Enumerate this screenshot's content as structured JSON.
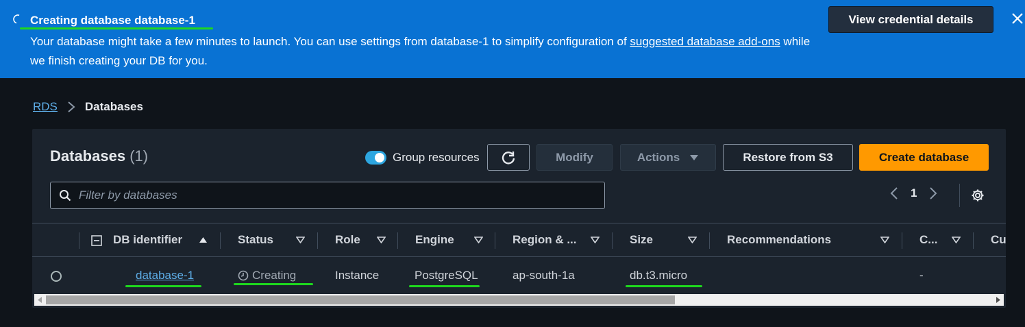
{
  "flash": {
    "title": "Creating database database-1",
    "message_prefix": "Your database might take a few minutes to launch. You can use settings from database-1 to simplify configuration of ",
    "message_link": "suggested database add-ons",
    "message_suffix": " while we finish creating your DB for you.",
    "view_credentials_label": "View credential details",
    "color": "#0972d3"
  },
  "breadcrumb": {
    "root": "RDS",
    "current": "Databases"
  },
  "panel": {
    "title": "Databases",
    "count": "(1)",
    "group_resources_label": "Group resources",
    "group_resources_enabled": true,
    "modify_label": "Modify",
    "actions_label": "Actions",
    "restore_label": "Restore from S3",
    "create_label": "Create database",
    "filter_placeholder": "Filter by databases",
    "page_number": "1"
  },
  "table": {
    "columns": [
      "DB identifier",
      "Status",
      "Role",
      "Engine",
      "Region & ...",
      "Size",
      "Recommendations",
      "C...",
      "Cu"
    ],
    "rows": [
      {
        "db_identifier": "database-1",
        "status": "Creating",
        "role": "Instance",
        "engine": "PostgreSQL",
        "region": "ap-south-1a",
        "size": "db.t3.micro",
        "recommendations": "",
        "c": "-"
      }
    ]
  },
  "colors": {
    "accent_orange": "#ff9900",
    "link_blue": "#5eaee8",
    "toggle_blue": "#2da6e0",
    "highlight_green": "#1ed81e"
  }
}
